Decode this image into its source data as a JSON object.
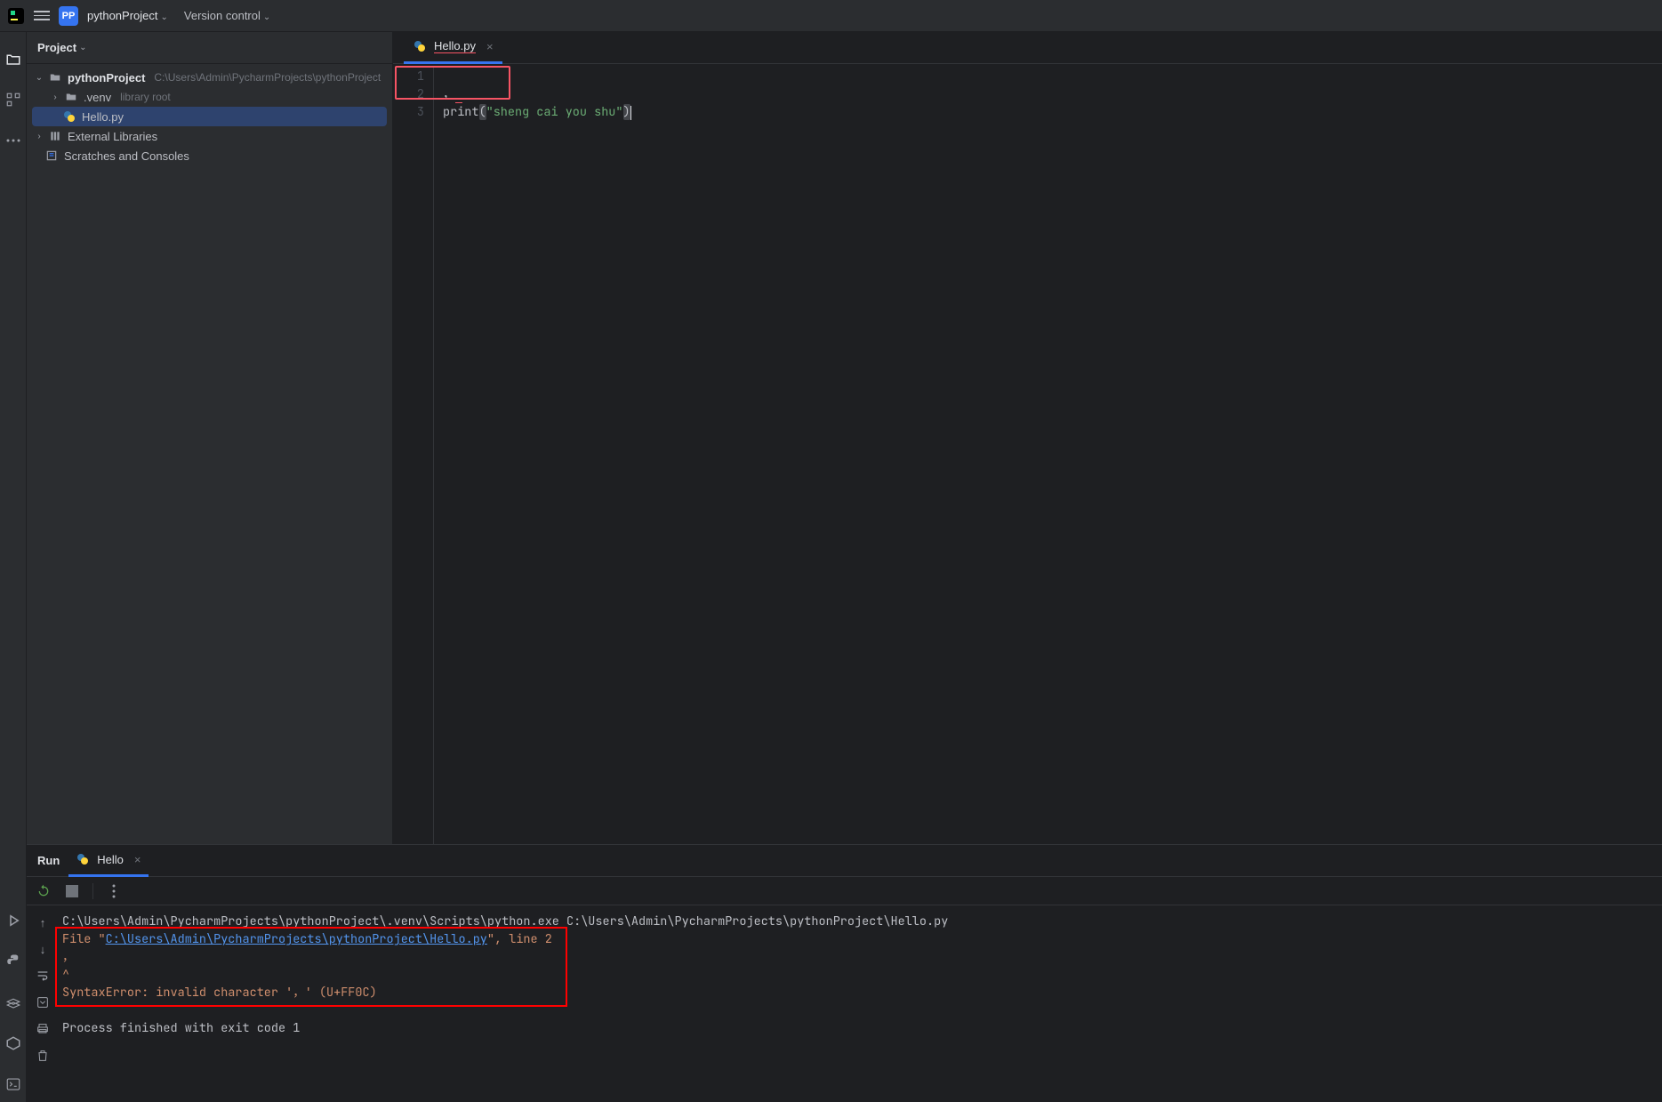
{
  "titlebar": {
    "project_badge": "PP",
    "project_name": "pythonProject",
    "vc": "Version control"
  },
  "project_panel": {
    "header": "Project",
    "nodes": {
      "root": "pythonProject",
      "root_hint": "C:\\Users\\Admin\\PycharmProjects\\pythonProject",
      "venv": ".venv",
      "venv_hint": "library root",
      "hello": "Hello.py",
      "ext_lib": "External Libraries",
      "scratches": "Scratches and Consoles"
    }
  },
  "editor": {
    "tab_name": "Hello.py",
    "lines": {
      "l1": "1",
      "l2": "2",
      "l3": "3"
    },
    "code_line2": "，",
    "code_print": "print",
    "code_lparen": "(",
    "code_string": "\"sheng cai you shu\"",
    "code_rparen": ")"
  },
  "run": {
    "header_label": "Run",
    "tab_label": "Hello",
    "command": "C:\\Users\\Admin\\PycharmProjects\\pythonProject\\.venv\\Scripts\\python.exe C:\\Users\\Admin\\PycharmProjects\\pythonProject\\Hello.py",
    "file_line_prefix": "  File \"",
    "file_path": "C:\\Users\\Admin\\PycharmProjects\\pythonProject\\Hello.py",
    "file_line_suffix": "\", line 2",
    "err_char": "    ，",
    "err_caret": "    ^",
    "syntax_err": "SyntaxError: invalid character '，' (U+FF0C)",
    "exit": "Process finished with exit code 1"
  }
}
